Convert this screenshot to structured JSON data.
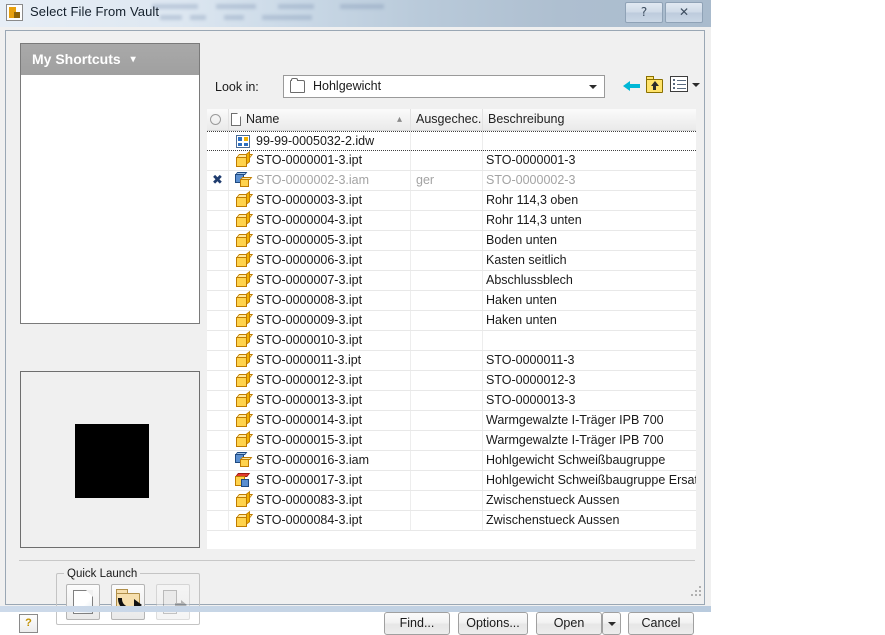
{
  "window": {
    "title": "Select File From Vault",
    "app_icon": "vault-app-icon",
    "help_button": "?",
    "close_button": "✕"
  },
  "shortcuts": {
    "header_label": "My Shortcuts",
    "caret": "▾",
    "items": []
  },
  "preview": {
    "label": "preview-thumbnail"
  },
  "lookin": {
    "label": "Look in:",
    "value": "Hohlgewicht",
    "folder_icon": "folder-icon",
    "dropdown_arrow": "▾"
  },
  "toolbar": {
    "back_icon": "back-arrow-icon",
    "up_icon": "up-one-level-icon",
    "views_icon": "views-menu-icon",
    "views_arrow": "▾"
  },
  "filelist": {
    "columns": [
      {
        "key": "select",
        "label": ""
      },
      {
        "key": "name",
        "label": "Name",
        "sort_indicator": "▴"
      },
      {
        "key": "checked_out",
        "label": "Ausgechec.."
      },
      {
        "key": "description",
        "label": "Beschreibung"
      }
    ],
    "rows": [
      {
        "icon": "idw",
        "flag": "",
        "name": "99-99-0005032-2.idw",
        "checked_out": "",
        "description": "",
        "state": "selected"
      },
      {
        "icon": "ipt",
        "flag": "",
        "name": "STO-0000001-3.ipt",
        "checked_out": "",
        "description": "STO-0000001-3",
        "state": "normal"
      },
      {
        "icon": "iam",
        "flag": "✖",
        "name": "STO-0000002-3.iam",
        "checked_out": "ger",
        "description": "STO-0000002-3",
        "state": "greyed"
      },
      {
        "icon": "ipt",
        "flag": "",
        "name": "STO-0000003-3.ipt",
        "checked_out": "",
        "description": "Rohr 114,3 oben",
        "state": "normal"
      },
      {
        "icon": "ipt",
        "flag": "",
        "name": "STO-0000004-3.ipt",
        "checked_out": "",
        "description": "Rohr 114,3 unten",
        "state": "normal"
      },
      {
        "icon": "ipt",
        "flag": "",
        "name": "STO-0000005-3.ipt",
        "checked_out": "",
        "description": "Boden unten",
        "state": "normal"
      },
      {
        "icon": "ipt",
        "flag": "",
        "name": "STO-0000006-3.ipt",
        "checked_out": "",
        "description": "Kasten seitlich",
        "state": "normal"
      },
      {
        "icon": "ipt",
        "flag": "",
        "name": "STO-0000007-3.ipt",
        "checked_out": "",
        "description": "Abschlussblech",
        "state": "normal"
      },
      {
        "icon": "ipt",
        "flag": "",
        "name": "STO-0000008-3.ipt",
        "checked_out": "",
        "description": "Haken unten",
        "state": "normal"
      },
      {
        "icon": "ipt",
        "flag": "",
        "name": "STO-0000009-3.ipt",
        "checked_out": "",
        "description": "Haken unten",
        "state": "normal"
      },
      {
        "icon": "ipt",
        "flag": "",
        "name": "STO-0000010-3.ipt",
        "checked_out": "",
        "description": "",
        "state": "normal"
      },
      {
        "icon": "ipt",
        "flag": "",
        "name": "STO-0000011-3.ipt",
        "checked_out": "",
        "description": "STO-0000011-3",
        "state": "normal"
      },
      {
        "icon": "ipt",
        "flag": "",
        "name": "STO-0000012-3.ipt",
        "checked_out": "",
        "description": "STO-0000012-3",
        "state": "normal"
      },
      {
        "icon": "ipt",
        "flag": "",
        "name": "STO-0000013-3.ipt",
        "checked_out": "",
        "description": "STO-0000013-3",
        "state": "normal"
      },
      {
        "icon": "ipt",
        "flag": "",
        "name": "STO-0000014-3.ipt",
        "checked_out": "",
        "description": "Warmgewalzte I-Träger IPB 700",
        "state": "normal"
      },
      {
        "icon": "ipt",
        "flag": "",
        "name": "STO-0000015-3.ipt",
        "checked_out": "",
        "description": "Warmgewalzte I-Träger IPB 700",
        "state": "normal"
      },
      {
        "icon": "iam",
        "flag": "",
        "name": "STO-0000016-3.iam",
        "checked_out": "",
        "description": "Hohlgewicht Schweißbaugruppe",
        "state": "normal"
      },
      {
        "icon": "sub",
        "flag": "",
        "name": "STO-0000017-3.ipt",
        "checked_out": "",
        "description": "Hohlgewicht Schweißbaugruppe Ersatzobjekt",
        "state": "normal"
      },
      {
        "icon": "ipt",
        "flag": "",
        "name": "STO-0000083-3.ipt",
        "checked_out": "",
        "description": "Zwischenstueck Aussen",
        "state": "normal"
      },
      {
        "icon": "ipt",
        "flag": "",
        "name": "STO-0000084-3.ipt",
        "checked_out": "",
        "description": "Zwischenstueck Aussen",
        "state": "normal"
      }
    ]
  },
  "quicklaunch": {
    "legend": "Quick Launch",
    "buttons": [
      {
        "id": "new",
        "icon": "new-document-icon",
        "enabled": true
      },
      {
        "id": "open",
        "icon": "open-folder-icon",
        "enabled": true
      },
      {
        "id": "exit",
        "icon": "exit-door-icon",
        "enabled": false
      }
    ]
  },
  "footer": {
    "help_label": "?",
    "find_label": "Find...",
    "options_label": "Options...",
    "open_label": "Open",
    "open_dropdown": "▾",
    "cancel_label": "Cancel"
  },
  "colors": {
    "title_gradient_start": "#e7eef6",
    "title_gradient_end": "#a9bbcd",
    "shortcuts_header": "#a9a9a9",
    "checkout_mark": "#1f3c6e",
    "part_icon": "#ffd34d",
    "assembly_icon": "#5b8fd0",
    "dialog_face": "#f0f0f0"
  }
}
